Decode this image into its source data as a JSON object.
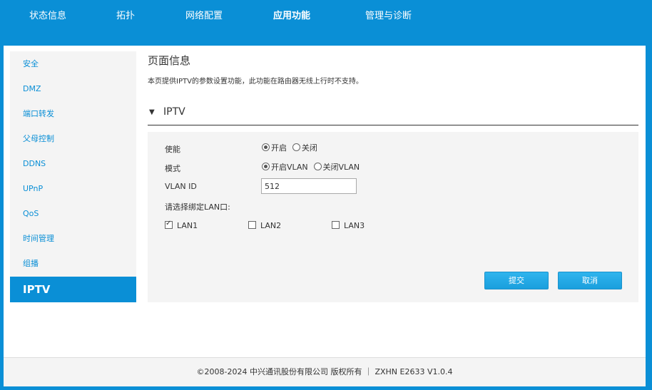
{
  "nav": {
    "items": [
      {
        "label": "状态信息"
      },
      {
        "label": "拓扑"
      },
      {
        "label": "网络配置"
      },
      {
        "label": "应用功能"
      },
      {
        "label": "管理与诊断"
      }
    ]
  },
  "sidebar": {
    "items": [
      {
        "label": "安全"
      },
      {
        "label": "DMZ"
      },
      {
        "label": "端口转发"
      },
      {
        "label": "父母控制"
      },
      {
        "label": "DDNS"
      },
      {
        "label": "UPnP"
      },
      {
        "label": "QoS"
      },
      {
        "label": "时间管理"
      },
      {
        "label": "组播"
      },
      {
        "label": "IPTV"
      }
    ]
  },
  "page": {
    "title": "页面信息",
    "description": "本页提供IPTV的参数设置功能，此功能在路由器无线上行时不支持。"
  },
  "section": {
    "title": "IPTV"
  },
  "form": {
    "enable": {
      "label": "使能",
      "on_label": "开启",
      "off_label": "关闭",
      "selected": "on"
    },
    "mode": {
      "label": "模式",
      "vlan_on_label": "开启VLAN",
      "vlan_off_label": "关闭VLAN",
      "selected": "vlan_on"
    },
    "vlan_id": {
      "label": "VLAN ID",
      "value": "512"
    },
    "bind_label": "请选择绑定LAN口:",
    "lans": [
      {
        "label": "LAN1",
        "checked": true
      },
      {
        "label": "LAN2",
        "checked": false
      },
      {
        "label": "LAN3",
        "checked": false
      }
    ],
    "submit_label": "提交",
    "cancel_label": "取消"
  },
  "footer": {
    "text": "©2008-2024 中兴通讯股份有限公司 版权所有 ｜ ZXHN E2633 V1.0.4"
  },
  "colors": {
    "brand": "#0a8fd6",
    "button": "#1a9fdd"
  }
}
